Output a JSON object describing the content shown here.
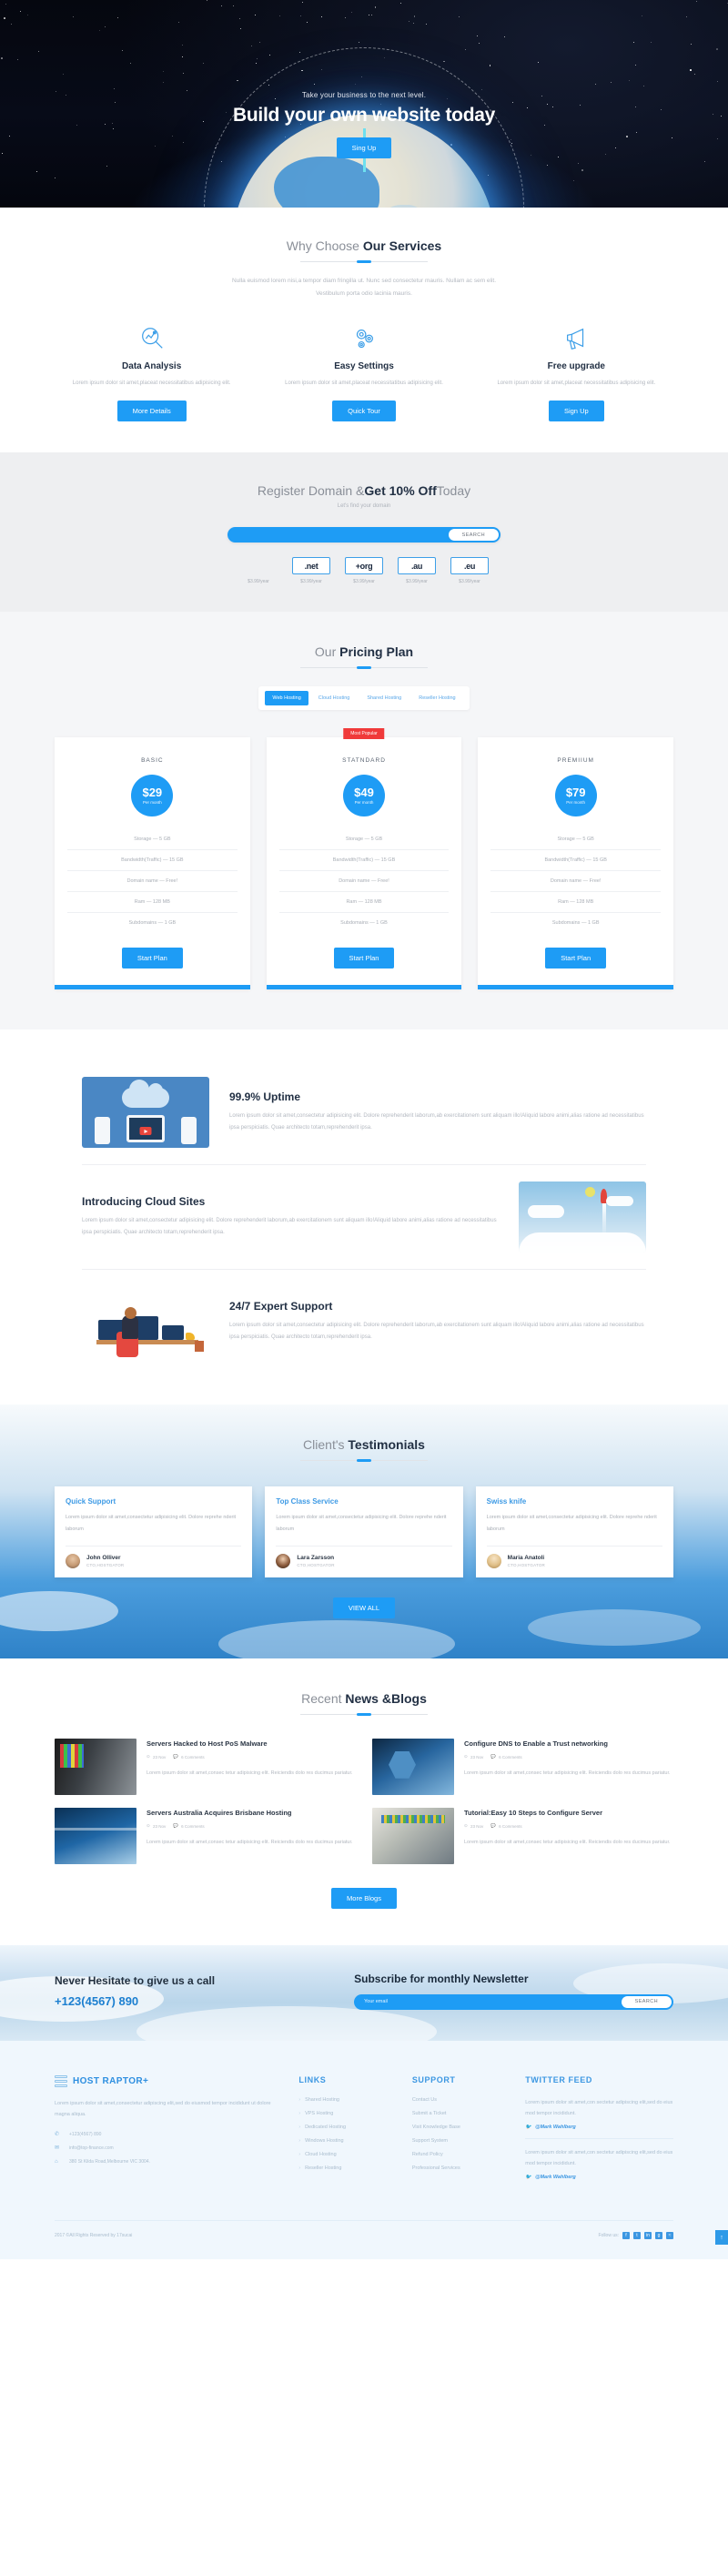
{
  "hero": {
    "subtitle": "Take your business to the next level.",
    "title": "Build your own website today",
    "cta": "Sing Up"
  },
  "services": {
    "title_light": "Why Choose ",
    "title_bold": "Our Services",
    "desc_line1": "Nulla euismod lorem nisi,a tempor diam fringilla ut. Nunc sed consectetur mauris. Nullam ac sem elit.",
    "desc_line2": "Vestibulum porta odio lacinia mauris.",
    "items": [
      {
        "icon": "magnifier-chart-icon",
        "title": "Data Analysis",
        "desc": "Lorem ipsum dolor sit amet,placeat necessitatibus adipisicing elit.",
        "button": "More Details"
      },
      {
        "icon": "gears-icon",
        "title": "Easy Settings",
        "desc": "Lorem ipsum dolor sit amet,placeat necessitatibus adipisicing elit.",
        "button": "Quick Tour"
      },
      {
        "icon": "megaphone-icon",
        "title": "Free upgrade",
        "desc": "Lorem ipsum dolor sit amet,placeat necessitatibus adipisicing elit.",
        "button": "Sign Up"
      }
    ]
  },
  "domain": {
    "title_light": "Register Domain &",
    "title_bold": "Get 10% Off",
    "title_tail": "Today",
    "subtitle": "Let's find your domain",
    "search_placeholder": "",
    "search_value": "",
    "search_button": "SEARCH",
    "tlds": [
      {
        "label": "",
        "price": "$3.99/year",
        "ghost": true
      },
      {
        "label": ".net",
        "price": "$3.99/year",
        "ghost": false
      },
      {
        "label": "+org",
        "price": "$3.99/year",
        "ghost": false
      },
      {
        "label": ".au",
        "price": "$3.99/year",
        "ghost": false
      },
      {
        "label": ".eu",
        "price": "$3.99/year",
        "ghost": false
      }
    ]
  },
  "pricing": {
    "title_light": "Our ",
    "title_bold": "Pricing Plan",
    "tabs": [
      {
        "label": "Web Hosting",
        "active": true
      },
      {
        "label": "Cloud Hosting",
        "active": false
      },
      {
        "label": "Shared Hosting",
        "active": false
      },
      {
        "label": "Reseller Hosting",
        "active": false
      }
    ],
    "plans": [
      {
        "badge": "",
        "name": "BASIC",
        "amount": "$29",
        "period": "Per month",
        "features": [
          "Storage — 5 GB",
          "Bandwidth(Traffic) — 15 GB",
          "Domain name — Free!",
          "Ram — 128 MB",
          "Subdomains — 1 GB"
        ],
        "button": "Start Plan"
      },
      {
        "badge": "Most Popular",
        "name": "STATNDARD",
        "amount": "$49",
        "period": "Per month",
        "features": [
          "Storage — 5 GB",
          "Bandwidth(Traffic) — 15 GB",
          "Domain name — Free!",
          "Ram — 128 MB",
          "Subdomains — 1 GB"
        ],
        "button": "Start Plan"
      },
      {
        "badge": "",
        "name": "PREMIIUM",
        "amount": "$79",
        "period": "Per month",
        "features": [
          "Storage — 5 GB",
          "Bandwidth(Traffic) — 15 GB",
          "Domain name — Free!",
          "Ram — 128 MB",
          "Subdomains — 1 GB"
        ],
        "button": "Start Plan"
      }
    ]
  },
  "features": [
    {
      "image": "cloud-devices-illustration",
      "title": "99.9% Uptime",
      "desc": "Lorem ipsum dolor sit amet,consectetur adipisicing elit. Dolore reprehenderit laborum,ab exercitationem sunt aliquam illo!Aliquid labore animi,alias ratione ad necessitatibus ipsa perspiciatis. Quae architecto totam,reprehenderit ipsa."
    },
    {
      "image": "rocket-clouds-illustration",
      "title": "Introducing Cloud Sites",
      "desc": "Lorem ipsum dolor sit amet,consectetur adipisicing elit. Dolore reprehenderit laborum,ab exercitationem sunt aliquam illo!Aliquid labore animi,alias ratione ad necessitatibus ipsa perspiciatis. Quae architecto totam,reprehenderit ipsa."
    },
    {
      "image": "developer-desk-illustration",
      "title": "24/7 Expert Support",
      "desc": "Lorem ipsum dolor sit amet,consectetur adipisicing elit. Dolore reprehenderit laborum,ab exercitationem sunt aliquam illo!Aliquid labore animi,alias ratione ad necessitatibus ipsa perspiciatis. Quae architecto totam,reprehenderit ipsa."
    }
  ],
  "testimonials": {
    "title_light": "Client's ",
    "title_bold": "Testimonials",
    "cards": [
      {
        "title": "Quick Support",
        "text": "Lorem ipsum dolor sit amet,consectetur adipisicing elit. Dolore reprehe nderit laborum",
        "name": "John Olliver",
        "role": "CTO,HOSTGATOR"
      },
      {
        "title": "Top Class Service",
        "text": "Lorem ipsum dolor sit amet,consectetur adipisicing elit. Dolore reprehe nderit laborum",
        "name": "Lara Zarsson",
        "role": "CTO,HOSTGATOR"
      },
      {
        "title": "Swiss knife",
        "text": "Lorem ipsum dolor sit amet,consectetur adipisicing elit. Dolore reprehe nderit laborum",
        "name": "Maria Anatoli",
        "role": "CTO,HOSTGATOR"
      }
    ],
    "view_all": "VIEW ALL"
  },
  "blog": {
    "title_light": "Recent ",
    "title_bold": "News &Blogs",
    "posts": [
      {
        "title": "Servers Hacked to Host PoS Malware",
        "date": "23 Nov",
        "comments": "6 Comments",
        "excerpt": "Lorem ipsum dolor sit amet,consec tetur adipisicing elit. Reiciendis dolo res ducimus pariatur."
      },
      {
        "title": "Configure DNS to Enable a Trust networking",
        "date": "23 Nov",
        "comments": "6 Comments",
        "excerpt": "Lorem ipsum dolor sit amet,consec tetur adipisicing elit. Reiciendis dolo res ducimus pariatur."
      },
      {
        "title": "Servers Australia Acquires Brisbane Hosting",
        "date": "23 Nov",
        "comments": "6 Comments",
        "excerpt": "Lorem ipsum dolor sit amet,consec tetur adipisicing elit. Reiciendis dolo res ducimus pariatur."
      },
      {
        "title": "Tutorial:Easy 10 Steps to Configure Server",
        "date": "23 Nov",
        "comments": "6 Comments",
        "excerpt": "Lorem ipsum dolor sit amet,consec tetur adipisicing elit. Reiciendis dolo res ducimus pariatur."
      }
    ],
    "more_button": "More Blogs"
  },
  "cta": {
    "call_title": "Never Hesitate to give us a call",
    "phone": "+123(4567) 890",
    "news_title": "Subscribe for monthly Newsletter",
    "email_placeholder": "Your email",
    "email_value": "",
    "news_button": "SEARCH"
  },
  "footer": {
    "brand": "HOST RAPTOR+",
    "about": "Lorem ipsum dolor sit amet,consectetur adipiscing elit,sed do eiusmod tempor incididunt ut dolore magna aliqua.",
    "contact": [
      {
        "icon": "phone-icon",
        "glyph": "✆",
        "text": "+123(4567) 890"
      },
      {
        "icon": "mail-icon",
        "glyph": "✉",
        "text": "info@top-finance.com"
      },
      {
        "icon": "location-icon",
        "glyph": "⌂",
        "text": "380 St Kilda Road,Melbourne VIC 3004."
      }
    ],
    "links_head": "LINKS",
    "links": [
      "Shared Hosting",
      "VPS Hosting",
      "Dedicated Hosting",
      "Windows Hosting",
      "Cloud Hosting",
      "Reseller Hosting"
    ],
    "support_head": "SUPPORT",
    "support": [
      "Contact Us",
      "Submit a Ticket",
      "Visit Knowledge Base",
      "Support System",
      "Refund Policy",
      "Professional Services"
    ],
    "twitter_head": "TWITTER FEED",
    "tweets": [
      {
        "text": "Lorem ipsum dolor sit amet,con sectetur adipiscing elit,sed do eius mod tempor incididunt.",
        "handle": "@Mark Wahlberg"
      },
      {
        "text": "Lorem ipsum dolor sit amet,con sectetur adipiscing elit,sed do eius mod tempor incididunt.",
        "handle": "@Mark Wahlberg"
      }
    ],
    "copyright": "2017 ©All Rights Reserved by 17sucai",
    "follow_label": "Follow us:",
    "social": [
      {
        "icon": "facebook-icon",
        "glyph": "f"
      },
      {
        "icon": "twitter-icon",
        "glyph": "t"
      },
      {
        "icon": "linkedin-icon",
        "glyph": "in"
      },
      {
        "icon": "google-plus-icon",
        "glyph": "g"
      },
      {
        "icon": "rss-icon",
        "glyph": "≈"
      }
    ],
    "to_top": "↑"
  },
  "colors": {
    "accent": "#1e9cf5",
    "dark": "#223044",
    "muted": "#b3b8c0",
    "danger": "#f03a3a"
  }
}
